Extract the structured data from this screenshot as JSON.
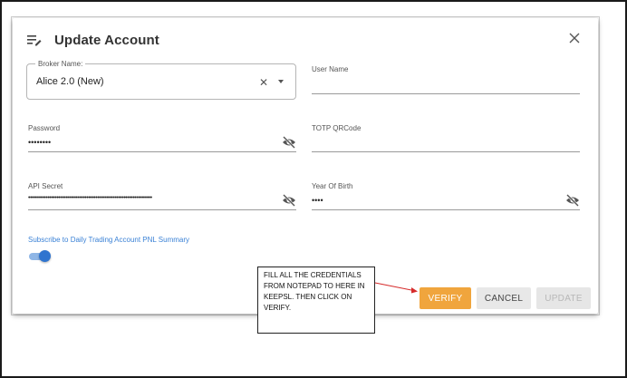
{
  "dialog": {
    "title": "Update Account",
    "broker": {
      "label": "Broker Name:",
      "value": "Alice 2.0 (New)"
    },
    "username": {
      "label": "User Name",
      "value": ""
    },
    "password": {
      "label": "Password",
      "value": "••••••••"
    },
    "totp": {
      "label": "TOTP QRCode",
      "value": ""
    },
    "api_secret": {
      "label": "API Secret",
      "value": "••••••••••••••••••••••••••••••••••••••••••••••••••••••••••••••••••••••"
    },
    "year_of_birth": {
      "label": "Year Of Birth",
      "value": "••••"
    },
    "subscribe": {
      "label": "Subscribe to Daily Trading Account PNL Summary",
      "on": true
    },
    "buttons": {
      "verify": "VERIFY",
      "cancel": "CANCEL",
      "update": "UPDATE"
    }
  },
  "callout": {
    "text": "FILL ALL THE CREDENTIALS FROM NOTEPAD TO HERE IN KEEPSL. THEN CLICK ON VERIFY."
  },
  "colors": {
    "accent": "#f0a53d",
    "toggle": "#2f74cf",
    "link": "#3b82d6"
  },
  "icons": {
    "title": "edit-list-icon",
    "close": "close-icon",
    "visibility": "visibility-off-icon"
  }
}
